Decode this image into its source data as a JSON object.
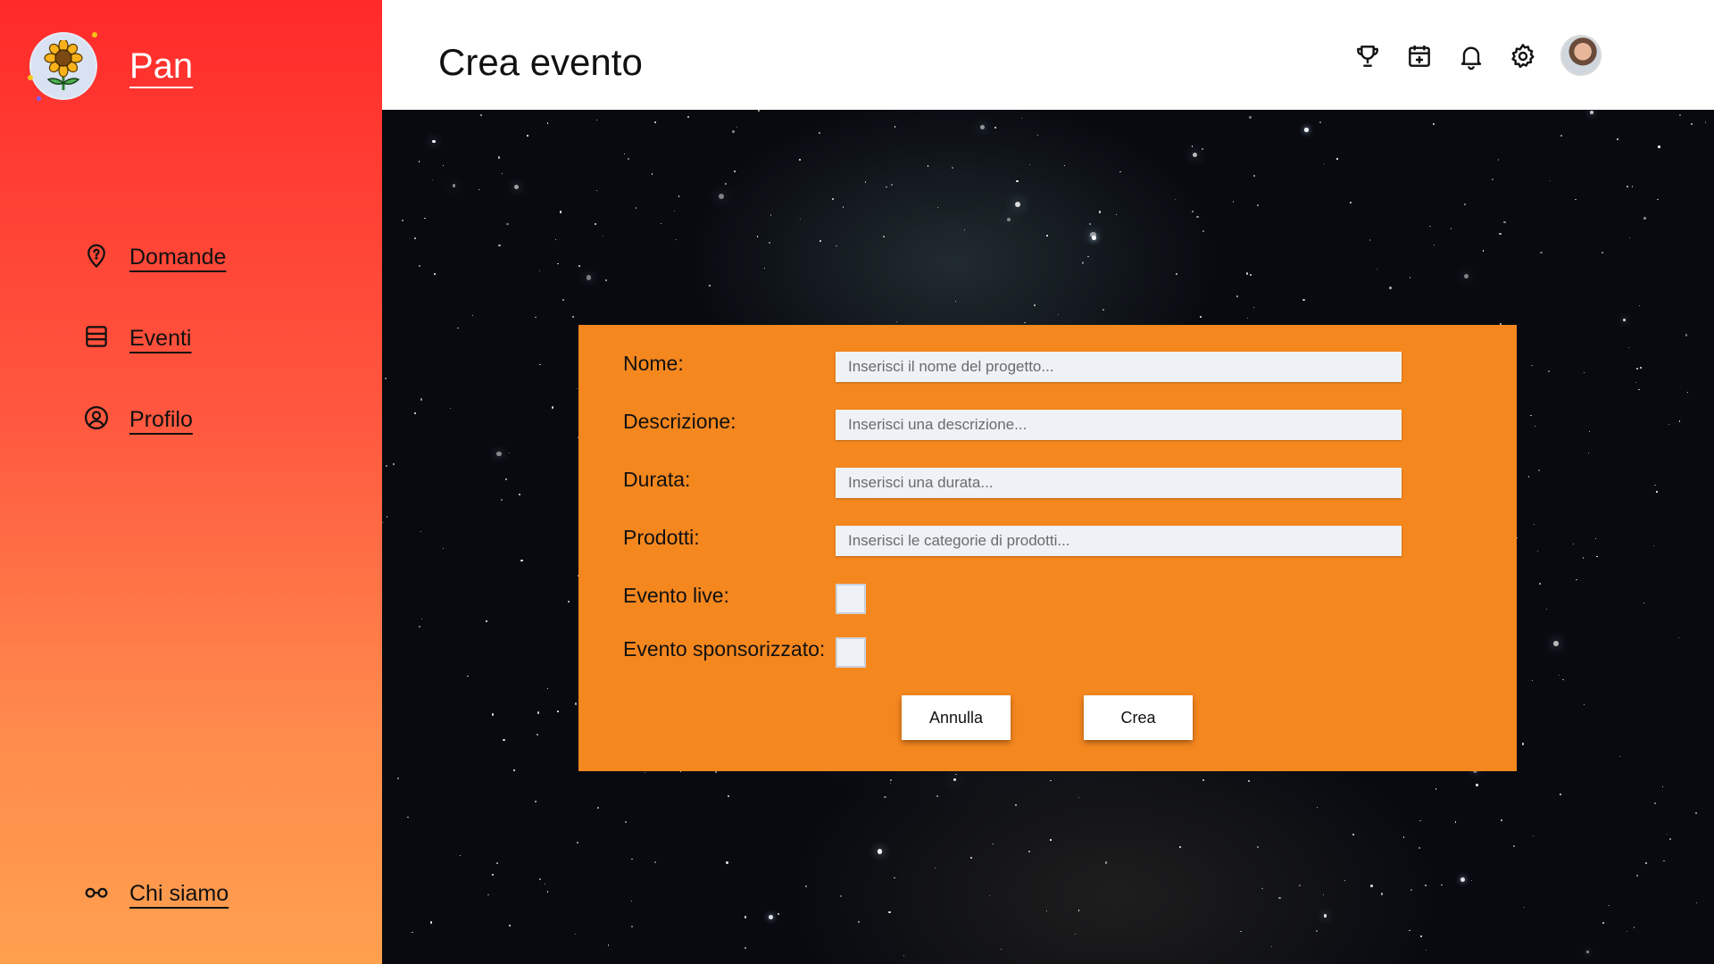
{
  "app": {
    "name": "Pan"
  },
  "sidebar": {
    "items": [
      {
        "label": "Domande",
        "icon": "map-pin-icon"
      },
      {
        "label": "Eventi",
        "icon": "list-icon"
      },
      {
        "label": "Profilo",
        "icon": "user-circle-icon"
      }
    ],
    "footer_item": {
      "label": "Chi siamo",
      "icon": "glasses-icon"
    }
  },
  "header": {
    "title": "Crea evento",
    "icons": [
      "trophy-icon",
      "calendar-plus-icon",
      "bell-icon",
      "settings-icon",
      "avatar"
    ]
  },
  "form": {
    "fields": [
      {
        "label": "Nome:",
        "placeholder": "Inserisci il nome del progetto...",
        "value": ""
      },
      {
        "label": "Descrizione:",
        "placeholder": "Inserisci una descrizione...",
        "value": ""
      },
      {
        "label": "Durata:",
        "placeholder": "Inserisci una durata...",
        "value": ""
      },
      {
        "label": "Prodotti:",
        "placeholder": "Inserisci le categorie di prodotti...",
        "value": ""
      }
    ],
    "checkboxes": [
      {
        "label": "Evento live:",
        "checked": false
      },
      {
        "label": "Evento sponsorizzato:",
        "checked": false
      }
    ],
    "cancel_label": "Annulla",
    "submit_label": "Crea"
  },
  "colors": {
    "sidebar_top": "#ff2a2a",
    "sidebar_bottom": "#ffa04e",
    "panel": "#f5871f",
    "input_bg": "#eef2f6"
  }
}
